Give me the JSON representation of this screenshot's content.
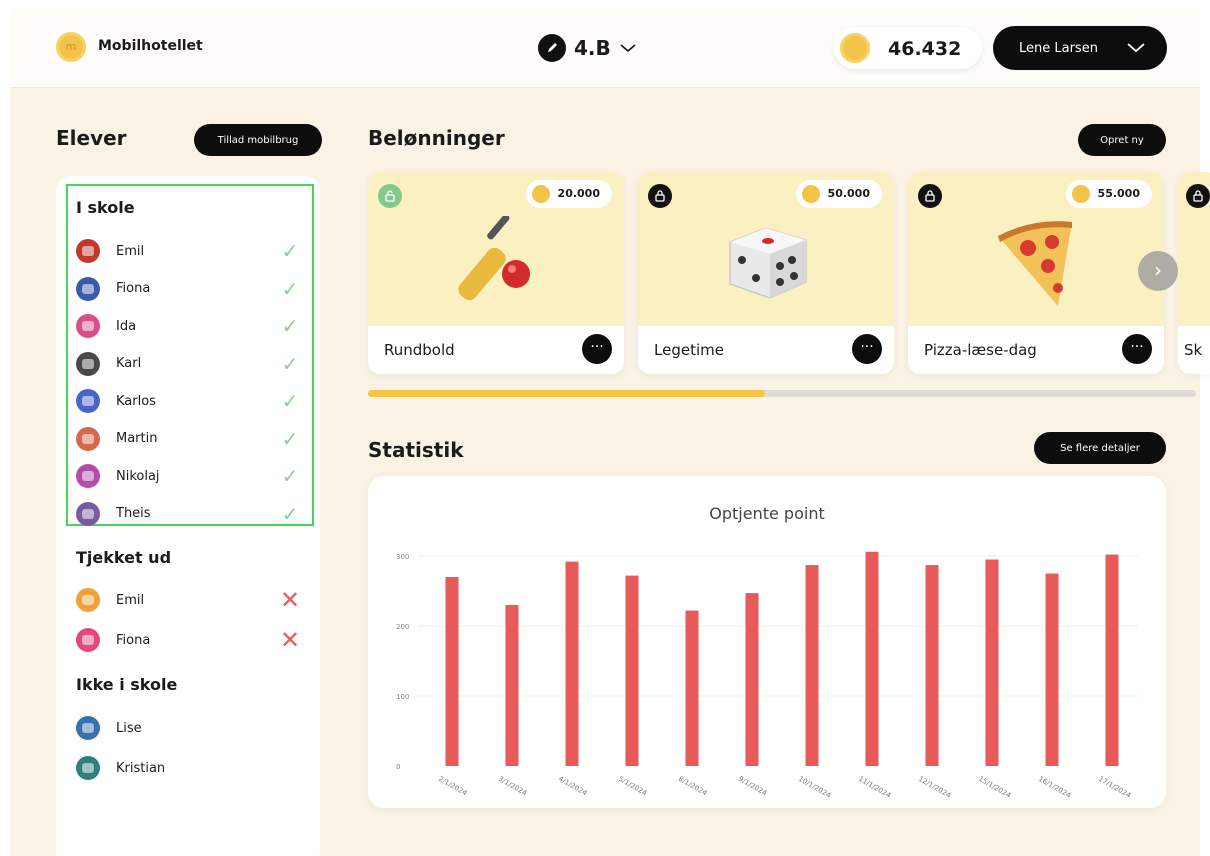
{
  "header": {
    "app_name": "Mobilhotellet",
    "class_name": "4.B",
    "coin_balance": "46.432",
    "user_name": "Lene Larsen"
  },
  "students": {
    "title": "Elever",
    "allow_button": "Tillad mobilbrug",
    "groups": [
      {
        "title": "I skole",
        "status": "checked-in",
        "items": [
          {
            "name": "Emil",
            "color": "#c0392b"
          },
          {
            "name": "Fiona",
            "color": "#3b5ba9"
          },
          {
            "name": "Ida",
            "color": "#d94f8a"
          },
          {
            "name": "Karl",
            "color": "#4a4a4a"
          },
          {
            "name": "Karlos",
            "color": "#4c63c9"
          },
          {
            "name": "Martin",
            "color": "#d4694e"
          },
          {
            "name": "Nikolaj",
            "color": "#b34ba8"
          },
          {
            "name": "Theis",
            "color": "#7a5a9e"
          }
        ]
      },
      {
        "title": "Tjekket ud",
        "status": "checked-out",
        "items": [
          {
            "name": "Emil",
            "color": "#f0a23a"
          },
          {
            "name": "Fiona",
            "color": "#e24a7a"
          }
        ]
      },
      {
        "title": "Ikke i skole",
        "status": "absent",
        "items": [
          {
            "name": "Lise",
            "color": "#3a6fb0"
          },
          {
            "name": "Kristian",
            "color": "#2f7f7a"
          }
        ]
      }
    ]
  },
  "rewards": {
    "title": "Belønninger",
    "create_button": "Opret ny",
    "items": [
      {
        "name": "Rundbold",
        "price": "20.000",
        "unlocked": true,
        "icon": "cricket-bat-icon"
      },
      {
        "name": "Legetime",
        "price": "50.000",
        "unlocked": false,
        "icon": "dice-icon"
      },
      {
        "name": "Pizza-læse-dag",
        "price": "55.000",
        "unlocked": false,
        "icon": "pizza-icon"
      },
      {
        "name": "Sk",
        "price": "",
        "unlocked": false,
        "icon": "lock-icon"
      }
    ],
    "scroll_progress": 0.48
  },
  "stats": {
    "title": "Statistik",
    "details_button": "Se flere detaljer"
  },
  "chart_data": {
    "type": "bar",
    "title": "Optjente point",
    "categories": [
      "2/1/2024",
      "3/1/2024",
      "4/1/2024",
      "5/1/2024",
      "8/1/2024",
      "9/1/2024",
      "10/1/2024",
      "11/1/2024",
      "12/1/2024",
      "15/1/2024",
      "16/1/2024",
      "17/1/2024"
    ],
    "values": [
      270,
      230,
      292,
      272,
      222,
      247,
      287,
      306,
      287,
      295,
      275,
      302
    ],
    "ylim": [
      0,
      300
    ],
    "yticks": [
      "0",
      "100",
      "200",
      "300"
    ],
    "color": "#e85a5a",
    "grid": true
  }
}
